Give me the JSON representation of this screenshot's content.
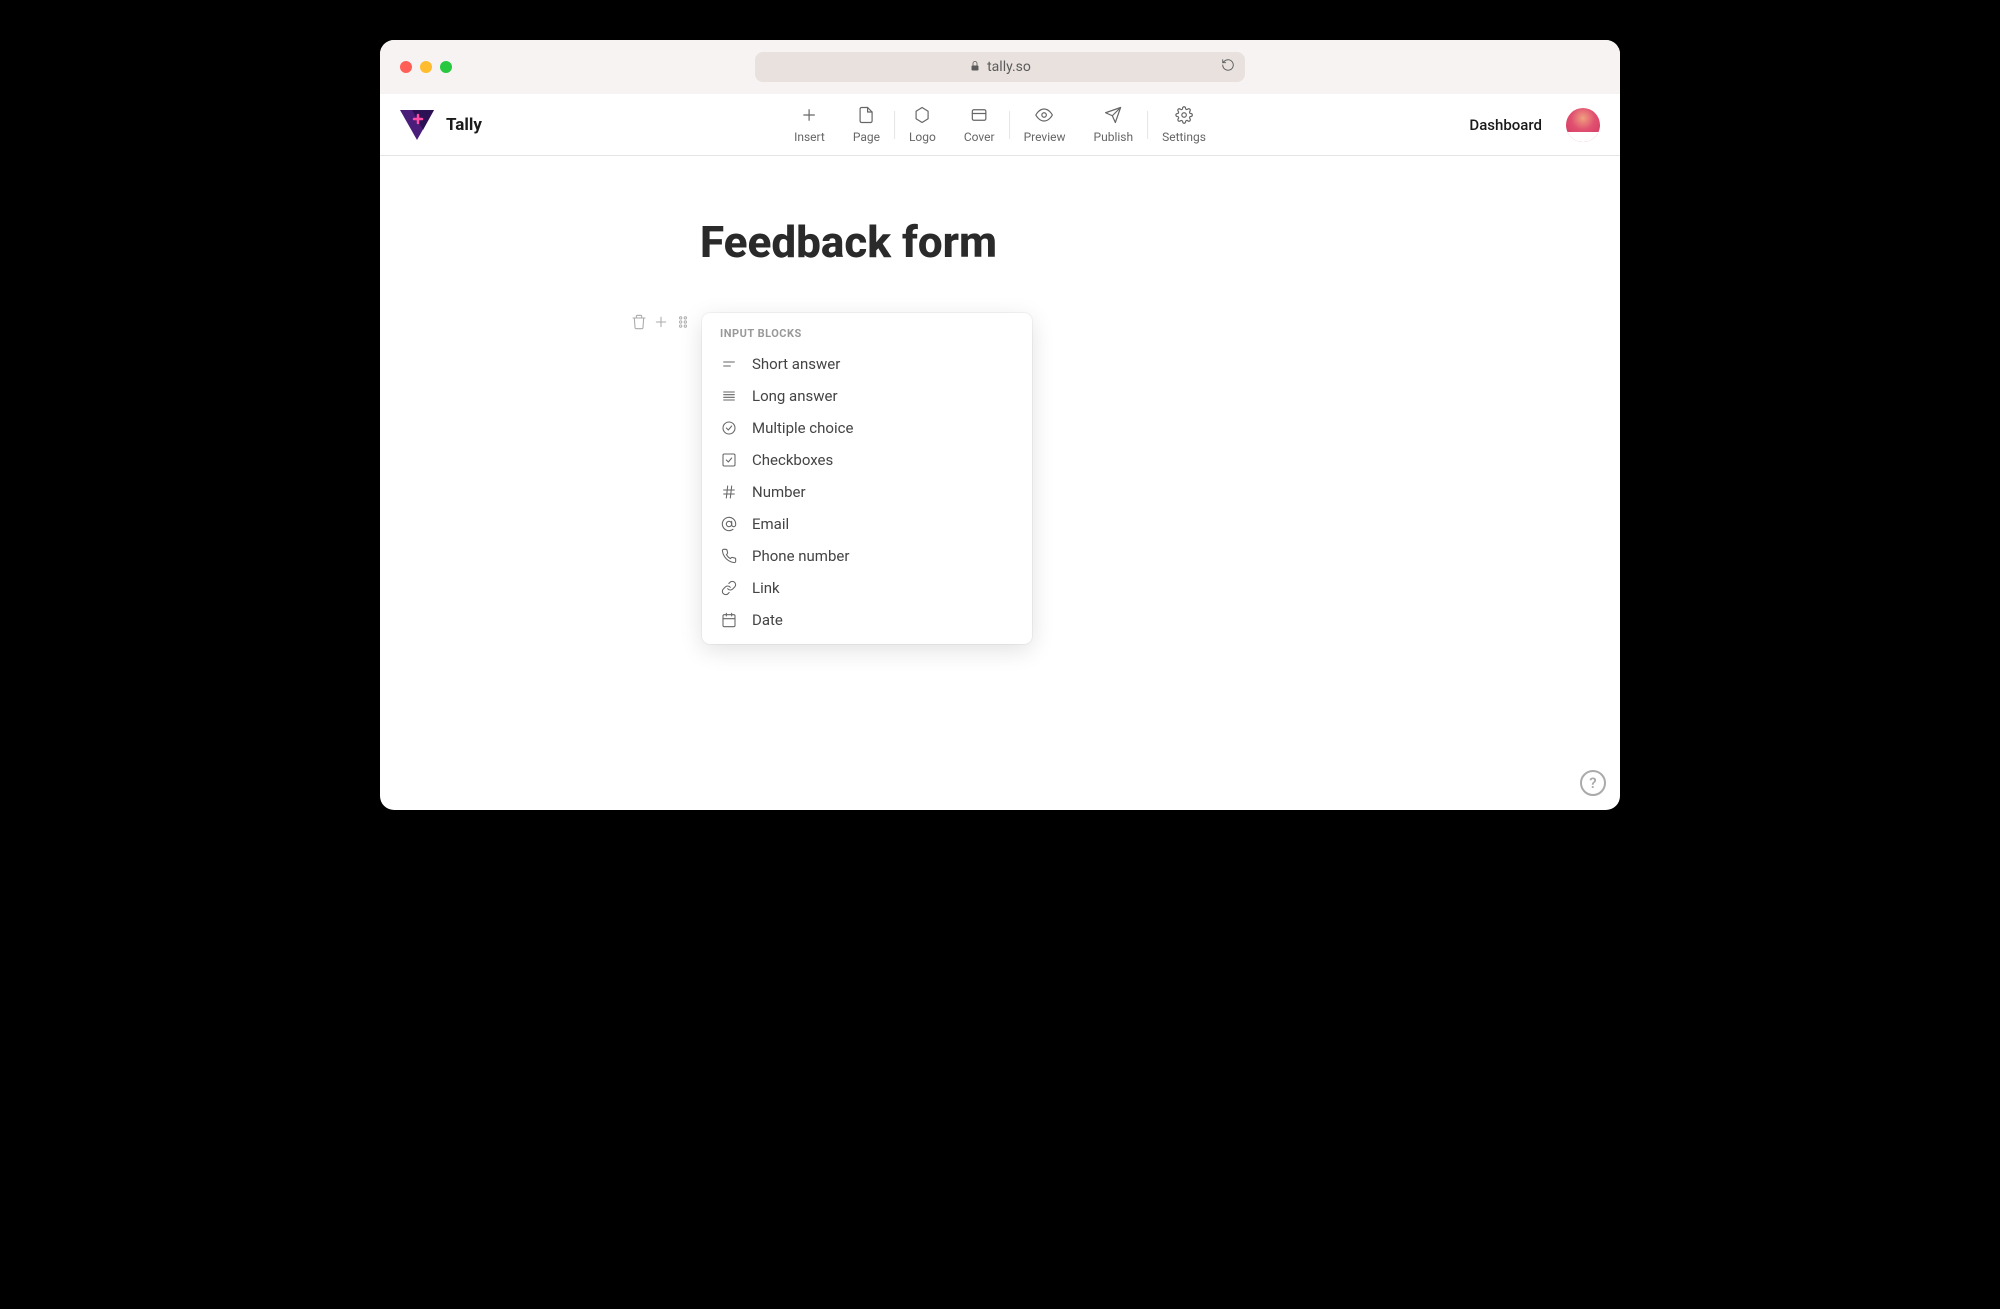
{
  "browser": {
    "url": "tally.so"
  },
  "header": {
    "brand": "Tally",
    "toolbar": [
      {
        "icon": "plus-icon",
        "label": "Insert"
      },
      {
        "icon": "page-icon",
        "label": "Page"
      },
      {
        "icon": "hexagon-icon",
        "label": "Logo"
      },
      {
        "icon": "rectangle-icon",
        "label": "Cover"
      },
      {
        "icon": "eye-icon",
        "label": "Preview"
      },
      {
        "icon": "send-icon",
        "label": "Publish"
      },
      {
        "icon": "gear-icon",
        "label": "Settings"
      }
    ],
    "dashboard_label": "Dashboard"
  },
  "form": {
    "title": "Feedback form",
    "slash_text": "/"
  },
  "dropdown": {
    "section_header": "INPUT BLOCKS",
    "items": [
      {
        "icon": "short-answer-icon",
        "label": "Short answer"
      },
      {
        "icon": "long-answer-icon",
        "label": "Long answer"
      },
      {
        "icon": "multiple-choice-icon",
        "label": "Multiple choice"
      },
      {
        "icon": "checkboxes-icon",
        "label": "Checkboxes"
      },
      {
        "icon": "number-icon",
        "label": "Number"
      },
      {
        "icon": "email-icon",
        "label": "Email"
      },
      {
        "icon": "phone-icon",
        "label": "Phone number"
      },
      {
        "icon": "link-icon",
        "label": "Link"
      },
      {
        "icon": "date-icon",
        "label": "Date"
      }
    ]
  },
  "help": {
    "label": "?"
  }
}
